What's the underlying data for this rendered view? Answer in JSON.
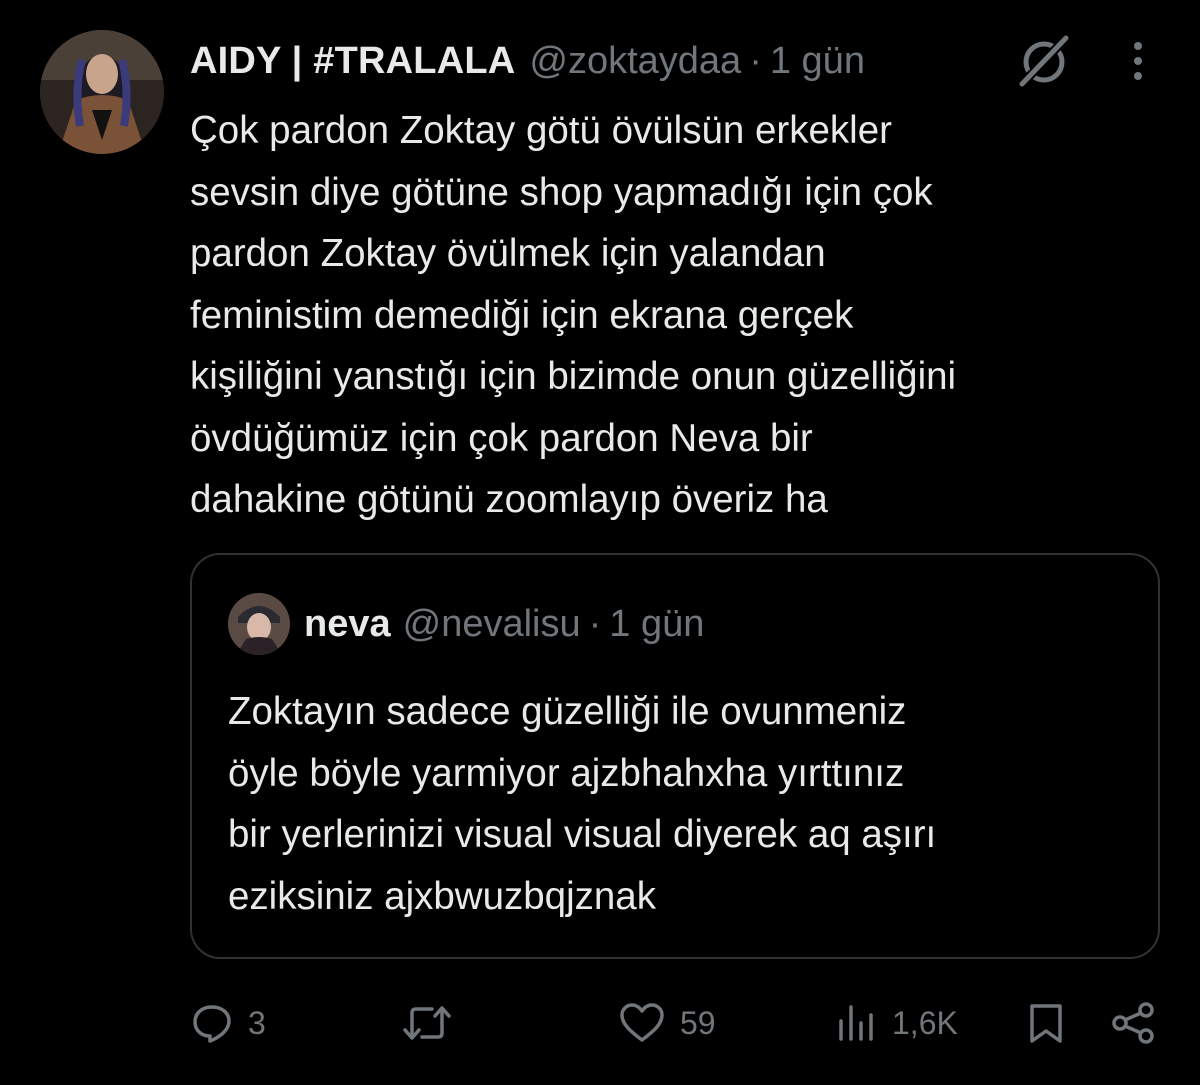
{
  "tweet": {
    "display_name": "AIDY | #TRALALA",
    "handle": "@zoktaydaa",
    "separator": "·",
    "time": "1 gün",
    "text": "Çok pardon Zoktay götü övülsün erkekler\nsevsin diye götüne shop yapmadığı için çok\npardon Zoktay övülmek için yalandan\nfeministim demediği için ekrana gerçek\nkişiliğini yanstığı için bizimde onun güzelliğini\növdüğümüz için çok pardon Neva bir\ndahakine götünü zoomlayıp överiz ha"
  },
  "quote": {
    "display_name": "neva",
    "handle": "@nevalisu",
    "separator": "·",
    "time": "1 gün",
    "text": "Zoktayın sadece güzelliği ile ovunmeniz\nöyle böyle yarmiyor ajzbhahxha yırttınız\nbir yerlerinizi visual visual diyerek aq aşırı\neziksiniz ajxbwuzbqjznak"
  },
  "actions": {
    "replies": "3",
    "reposts": "",
    "likes": "59",
    "views": "1,6K"
  },
  "icons": {
    "header_right": [
      "grok-icon",
      "more-icon"
    ],
    "action_bar": [
      "reply-icon",
      "repost-icon",
      "like-icon",
      "views-icon",
      "bookmark-icon",
      "share-icon"
    ]
  },
  "colors": {
    "background": "#000000",
    "text_primary": "#e7e9ea",
    "text_secondary": "#71767b",
    "border": "#2f3336"
  }
}
